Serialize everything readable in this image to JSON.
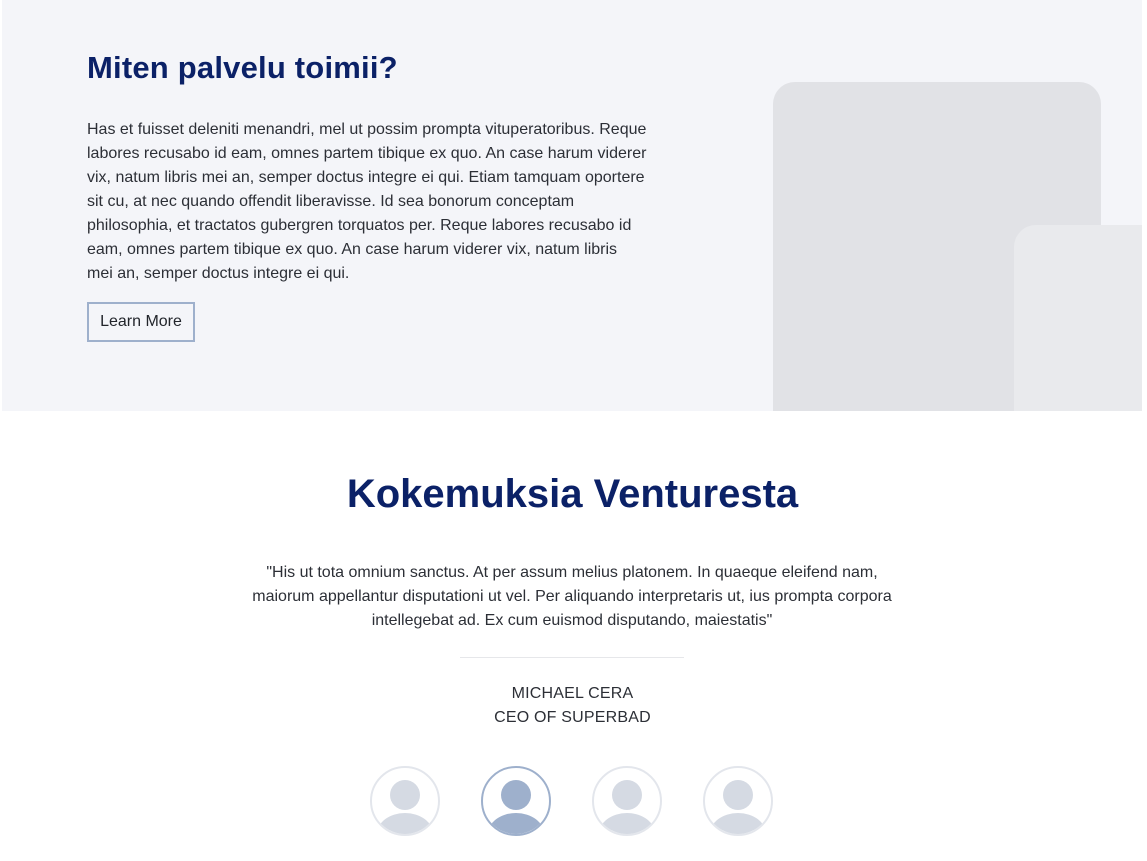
{
  "hero": {
    "title": "Miten palvelu toimii?",
    "text": "Has et fuisset deleniti menandri, mel ut possim prompta vituperatoribus. Reque labores recusabo id eam, omnes partem tibique ex quo. An case harum viderer vix, natum libris mei an, semper doctus integre ei qui. Etiam tamquam oportere sit cu, at nec quando offendit liberavisse. Id sea bonorum conceptam philosophia, et tractatos gubergren torquatos per. Reque labores recusabo id eam, omnes partem tibique ex quo. An case harum viderer vix, natum libris mei an, semper doctus integre ei qui.",
    "button_label": "Learn More"
  },
  "testimonials": {
    "title": "Kokemuksia Venturesta",
    "quote": "\"His ut tota omnium sanctus. At per assum melius platonem. In quaeque eleifend nam, maiorum appellantur disputationi ut vel. Per aliquando interpretaris ut, ius prompta corpora intellegebat ad. Ex cum euismod disputando, maiestatis\"",
    "author_name": "MICHAEL CERA",
    "author_role": "CEO OF SUPERBAD",
    "avatars": [
      {
        "icon": "user-avatar-icon",
        "active": false
      },
      {
        "icon": "user-avatar-icon",
        "active": true
      },
      {
        "icon": "user-avatar-icon",
        "active": false
      },
      {
        "icon": "user-avatar-icon",
        "active": false
      }
    ]
  },
  "colors": {
    "heading": "#0b2167",
    "hero_background": "#f4f5f9",
    "button_border": "#9eb0cc",
    "avatar_inactive": "#d5dae3",
    "avatar_active": "#9eb0cc"
  }
}
